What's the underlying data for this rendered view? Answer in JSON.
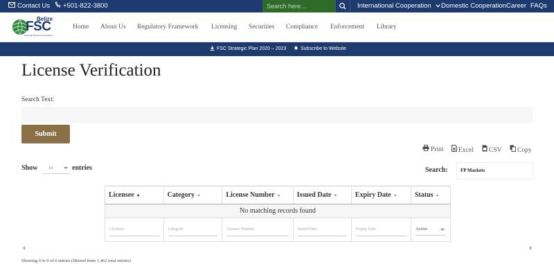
{
  "topbar": {
    "contact_label": "Contact Us",
    "phone": "+501-822-3800",
    "search_placeholder": "Search here...",
    "international_label": "International Cooperation",
    "domestic_label": "Domestic Cooperation",
    "career_label": "Career",
    "faqs_label": "FAQs"
  },
  "logo": {
    "word_top": "Belize",
    "word_main": "FSC",
    "tagline": "Financial Services Commission"
  },
  "nav": {
    "items": [
      "Home",
      "About Us",
      "Regulatory Framework",
      "Licensing",
      "Securities",
      "Compliance",
      "Enforcement",
      "Library"
    ]
  },
  "stratbar": {
    "plan_label": "FSC Strategic Plan 2020 – 2023",
    "subscribe_label": "Subscribe to Website"
  },
  "page": {
    "title": "License Verification",
    "search_label": "Search Text:",
    "submit_label": "Submit"
  },
  "export": {
    "print": "Print",
    "excel": "Excel",
    "csv": "CSV",
    "copy": "Copy"
  },
  "table_controls": {
    "show_label": "Show",
    "length_value": "10",
    "entries_label": "entries",
    "search_label": "Search:",
    "search_value": "FP Markets"
  },
  "table": {
    "columns": [
      "Licensee",
      "Category",
      "License Number",
      "Issued Date",
      "Expiry Date",
      "Status"
    ],
    "empty_message": "No matching records found",
    "filter_placeholders": [
      "Licensee",
      "Category",
      "License Number",
      "Issued Date",
      "Expiry Date"
    ],
    "status_filter_value": "Active"
  },
  "info": "Showing 0 to 0 of 0 entries (filtered from 1,462 total entries)",
  "colors": {
    "topbar": "#1c3a6e",
    "search_bg": "#2e6b2a",
    "submit": "#8b6f47",
    "logo_green": "#2e8b3e"
  }
}
